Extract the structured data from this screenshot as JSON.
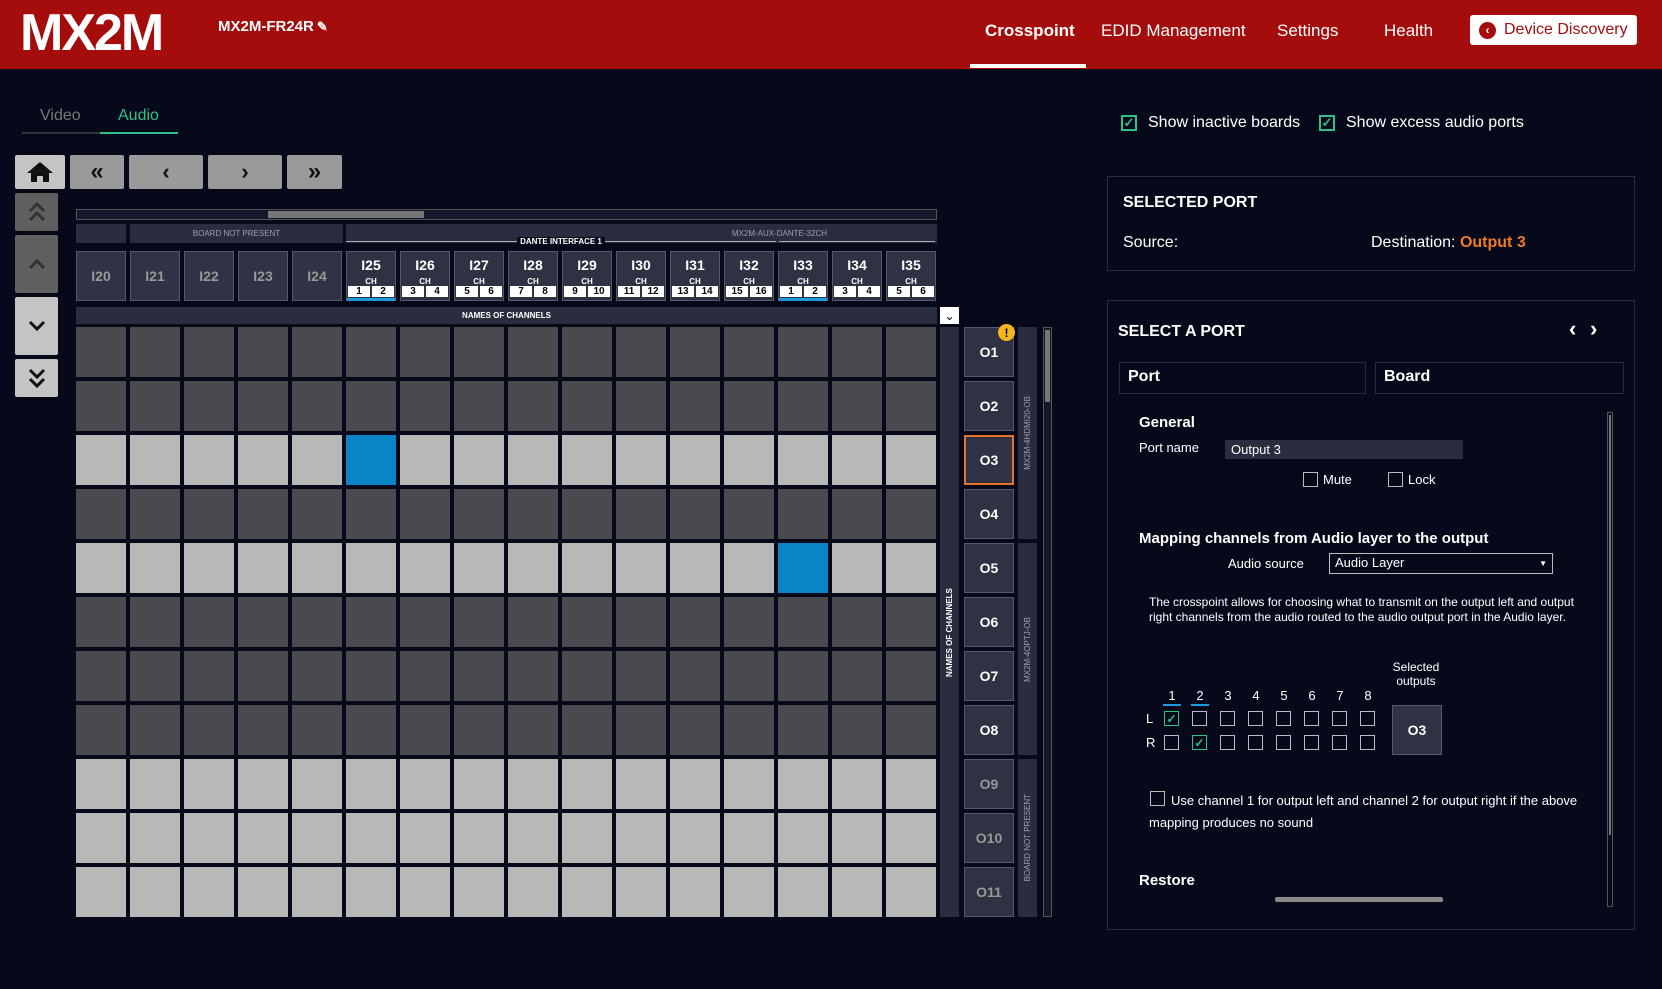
{
  "header": {
    "logo": "MX2M",
    "device_name": "MX2M-FR24R",
    "nav": [
      "Crosspoint",
      "EDID Management",
      "Settings",
      "Health"
    ],
    "discovery_button": "Device Discovery"
  },
  "tabs": {
    "video": "Video",
    "audio": "Audio"
  },
  "colors": {
    "accent": "#2ec08a",
    "brand": "#a50d0d",
    "selected_cell": "#0a86c6",
    "destination": "#ef7a24"
  },
  "grid": {
    "board_not_present": "BOARD NOT PRESENT",
    "board_name": "MX2M-AUX-DANTE-32CH",
    "dante_interface": "DANTE INTERFACE 1",
    "names_of_channels": "NAMES OF CHANNELS",
    "ch_label": "CH",
    "inactive_inputs": [
      "I20",
      "I21",
      "I22",
      "I23",
      "I24"
    ],
    "inputs": [
      {
        "name": "I25",
        "ch": [
          "1",
          "2"
        ]
      },
      {
        "name": "I26",
        "ch": [
          "3",
          "4"
        ]
      },
      {
        "name": "I27",
        "ch": [
          "5",
          "6"
        ]
      },
      {
        "name": "I28",
        "ch": [
          "7",
          "8"
        ]
      },
      {
        "name": "I29",
        "ch": [
          "9",
          "10"
        ]
      },
      {
        "name": "I30",
        "ch": [
          "11",
          "12"
        ]
      },
      {
        "name": "I31",
        "ch": [
          "13",
          "14"
        ]
      },
      {
        "name": "I32",
        "ch": [
          "15",
          "16"
        ]
      },
      {
        "name": "I33",
        "ch": [
          "1",
          "2"
        ]
      },
      {
        "name": "I34",
        "ch": [
          "3",
          "4"
        ]
      },
      {
        "name": "I35",
        "ch": [
          "5",
          "6"
        ]
      }
    ],
    "outputs": [
      "O1",
      "O2",
      "O3",
      "O4",
      "O5",
      "O6",
      "O7",
      "O8",
      "O9",
      "O10",
      "O11"
    ],
    "row_boards": [
      "MX2M-4HDMI20-OB",
      "MX2M-4OPTJ-OB",
      "BOARD NOT PRESENT"
    ],
    "light_rows": [
      2,
      4,
      8,
      9,
      10
    ],
    "connections": [
      {
        "row": 2,
        "col": 5
      },
      {
        "row": 4,
        "col": 13
      }
    ]
  },
  "options": {
    "show_inactive": "Show inactive boards",
    "show_excess": "Show excess audio ports"
  },
  "selected_port": {
    "title": "SELECTED PORT",
    "source_label": "Source:",
    "dest_label": "Destination:",
    "dest_value": "Output 3"
  },
  "select_port": {
    "title": "SELECT A PORT",
    "tab_port": "Port",
    "tab_board": "Board",
    "general": "General",
    "port_name_label": "Port name",
    "port_name_value": "Output 3",
    "mute": "Mute",
    "lock": "Lock",
    "mapping_title": "Mapping channels from Audio layer to the output",
    "audio_source_label": "Audio source",
    "audio_source_value": "Audio Layer",
    "description": "The crosspoint allows for choosing what to transmit on the output left and output right channels from the audio routed to the audio output port in the Audio layer.",
    "selected_outputs_label": "Selected outputs",
    "channels": [
      "1",
      "2",
      "3",
      "4",
      "5",
      "6",
      "7",
      "8"
    ],
    "row_l": "L",
    "row_r": "R",
    "l_checked": 0,
    "r_checked": 1,
    "selected_output": "O3",
    "fallback_text": "Use channel 1 for output left and channel 2 for output right if the above mapping produces no sound",
    "restore": "Restore"
  }
}
